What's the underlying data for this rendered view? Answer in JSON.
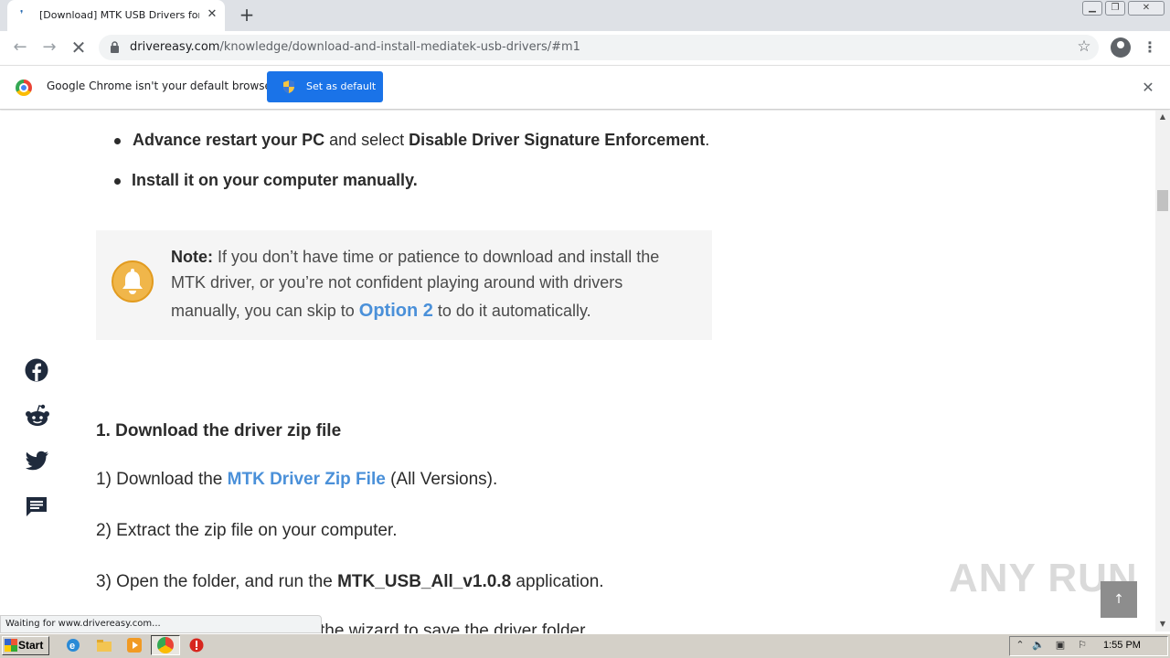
{
  "browser": {
    "tab_title": "[Download] MTK USB Drivers for Wir",
    "tab_close": "✕",
    "new_tab": "+",
    "url_host": "drivereasy.com",
    "url_path": "/knowledge/download-and-install-mediatek-usb-drivers/#m1",
    "infobar_text": "Google Chrome isn't your default browser",
    "set_default_label": "Set as default",
    "infobar_close": "✕",
    "status_text": "Waiting for www.drivereasy.com..."
  },
  "article": {
    "bullets": [
      {
        "bold1": "Advance restart your PC",
        "plain": " and select ",
        "bold2": "Disable Driver Signature Enforcement",
        "tail": "."
      },
      {
        "bold1": "Install it on your computer manually.",
        "plain": "",
        "bold2": "",
        "tail": ""
      }
    ],
    "note": {
      "label": "Note:",
      "line1": " If you don’t have time or patience to download and install the",
      "line2": "MTK driver, or you’re not confident playing around with drivers",
      "line3_pre": "manually, you can skip to ",
      "line3_link": "Option 2",
      "line3_post": " to do it automatically."
    },
    "heading": "1. Download the driver zip file",
    "step1_pre": "1) Download the ",
    "step1_link": "MTK Driver Zip File",
    "step1_post": " (All Versions).",
    "step2": "2) Extract the zip file on your computer.",
    "step3_pre": "3) Open the folder, and run the ",
    "step3_bold": "MTK_USB_All_v1.0.8",
    "step3_post": " application.",
    "step4_partial": "the wizard to save the driver folder."
  },
  "social": [
    "facebook-icon",
    "reddit-icon",
    "twitter-icon",
    "comment-icon"
  ],
  "watermark": "ANY RUN",
  "taskbar": {
    "start_label": "Start",
    "clock": "1:55 PM"
  },
  "colors": {
    "link": "#4a90d9",
    "set_default_button": "#1a73e8",
    "bell": "#f0b64a"
  }
}
